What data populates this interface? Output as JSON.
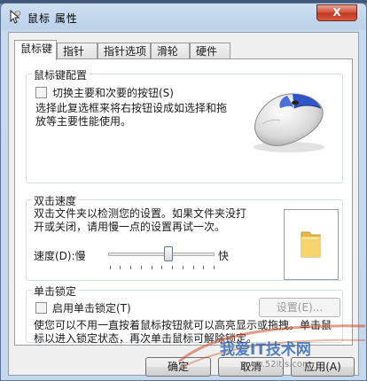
{
  "window": {
    "title": "鼠标 属性",
    "close_label": "X"
  },
  "tabs": [
    {
      "label": "鼠标键",
      "active": true
    },
    {
      "label": "指针",
      "active": false
    },
    {
      "label": "指针选项",
      "active": false
    },
    {
      "label": "滑轮",
      "active": false
    },
    {
      "label": "硬件",
      "active": false
    }
  ],
  "button_config": {
    "title": "鼠标键配置",
    "swap_label": "切换主要和次要的按钮(S)",
    "swap_checked": false,
    "description": "选择此复选框来将右按钮设成如选择和拖放等主要性能使用。"
  },
  "double_click": {
    "title": "双击速度",
    "description": "双击文件夹以检测您的设置。如果文件夹没打开或关闭，请用慢一点的设置再试一次。",
    "speed_label": "速度(D):慢",
    "fast_label": "快",
    "speed_level": 0.55
  },
  "click_lock": {
    "title": "单击锁定",
    "enable_label": "启用单击锁定(T)",
    "enable_checked": false,
    "settings_label": "设置(E)...",
    "description": "使您可以不用一直按着鼠标按钮就可以高亮显示或拖拽。单击鼠标以进入锁定状态，再次单击鼠标可解除锁定。"
  },
  "footer": {
    "ok": "确定",
    "cancel": "取消",
    "apply": "应用(A)"
  },
  "watermark": {
    "text": "我爱IT技术网",
    "url": "www.52itjs.com"
  },
  "colors": {
    "mouse_accent": "#2f56c9",
    "folder": "#f3cf63",
    "close": "#c93f25"
  }
}
